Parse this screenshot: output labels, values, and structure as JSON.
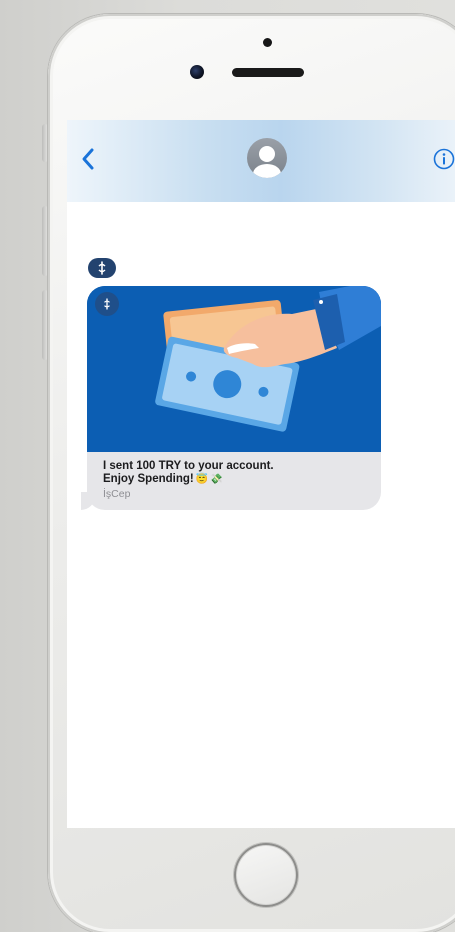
{
  "navbar": {
    "back_icon": "chevron-left-icon",
    "contact_icon": "contact-avatar-icon",
    "info_icon": "info-circle-icon",
    "accent_color": "#1a73d9"
  },
  "conversation": {
    "sender_badge_icon": "isbank-logo-icon",
    "message": {
      "image_icon": "hand-with-banknotes-illustration",
      "line1": "I sent 100 TRY to your account.",
      "line2": "Enjoy Spending!",
      "emoji": [
        "😇",
        "💸"
      ],
      "sender_name": "İşCep"
    }
  },
  "device": {
    "home_button_icon": "home-button"
  },
  "colors": {
    "bubble": "#e6e6e9",
    "hero_background": "#0c5eb3",
    "badge": "#23436f"
  }
}
